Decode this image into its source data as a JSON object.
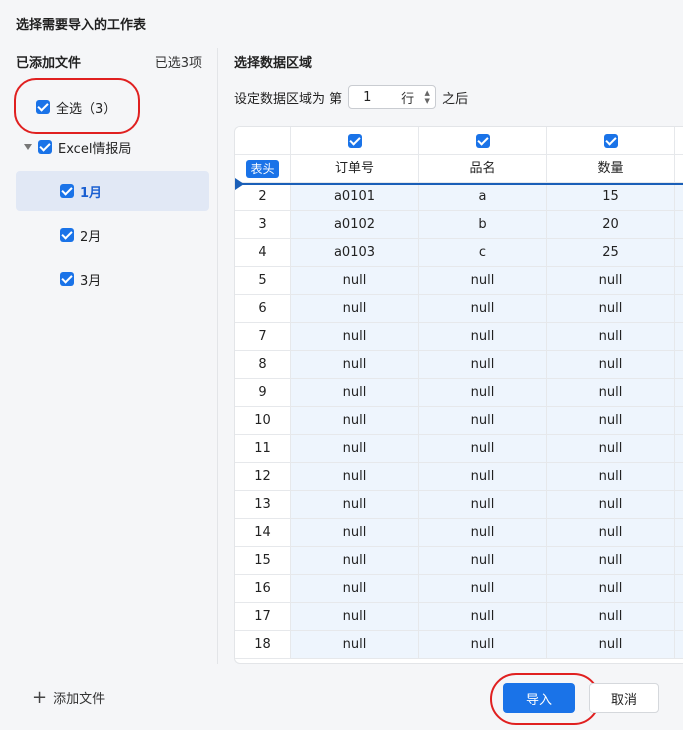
{
  "dialog": {
    "title": "选择需要导入的工作表"
  },
  "sidebar": {
    "title": "已添加文件",
    "selected_count": "已选3项",
    "select_all": "全选（3）",
    "file": "Excel情报局",
    "sheets": [
      "1月",
      "2月",
      "3月"
    ],
    "selected_sheet": "1月"
  },
  "range": {
    "title": "选择数据区域",
    "prefix": "设定数据区域为 第",
    "value": "1",
    "unit": "行",
    "suffix": "之后"
  },
  "table": {
    "header_badge": "表头",
    "columns": [
      "订单号",
      "品名",
      "数量"
    ],
    "rows": [
      [
        "2",
        "a0101",
        "a",
        "15"
      ],
      [
        "3",
        "a0102",
        "b",
        "20"
      ],
      [
        "4",
        "a0103",
        "c",
        "25"
      ],
      [
        "5",
        "null",
        "null",
        "null"
      ],
      [
        "6",
        "null",
        "null",
        "null"
      ],
      [
        "7",
        "null",
        "null",
        "null"
      ],
      [
        "8",
        "null",
        "null",
        "null"
      ],
      [
        "9",
        "null",
        "null",
        "null"
      ],
      [
        "10",
        "null",
        "null",
        "null"
      ],
      [
        "11",
        "null",
        "null",
        "null"
      ],
      [
        "12",
        "null",
        "null",
        "null"
      ],
      [
        "13",
        "null",
        "null",
        "null"
      ],
      [
        "14",
        "null",
        "null",
        "null"
      ],
      [
        "15",
        "null",
        "null",
        "null"
      ],
      [
        "16",
        "null",
        "null",
        "null"
      ],
      [
        "17",
        "null",
        "null",
        "null"
      ],
      [
        "18",
        "null",
        "null",
        "null"
      ]
    ]
  },
  "footer": {
    "add_file": "添加文件",
    "import": "导入",
    "cancel": "取消"
  },
  "colors": {
    "accent": "#1a73e8",
    "highlight_ring": "#e02020",
    "data_cell_bg": "#eef5fd"
  }
}
